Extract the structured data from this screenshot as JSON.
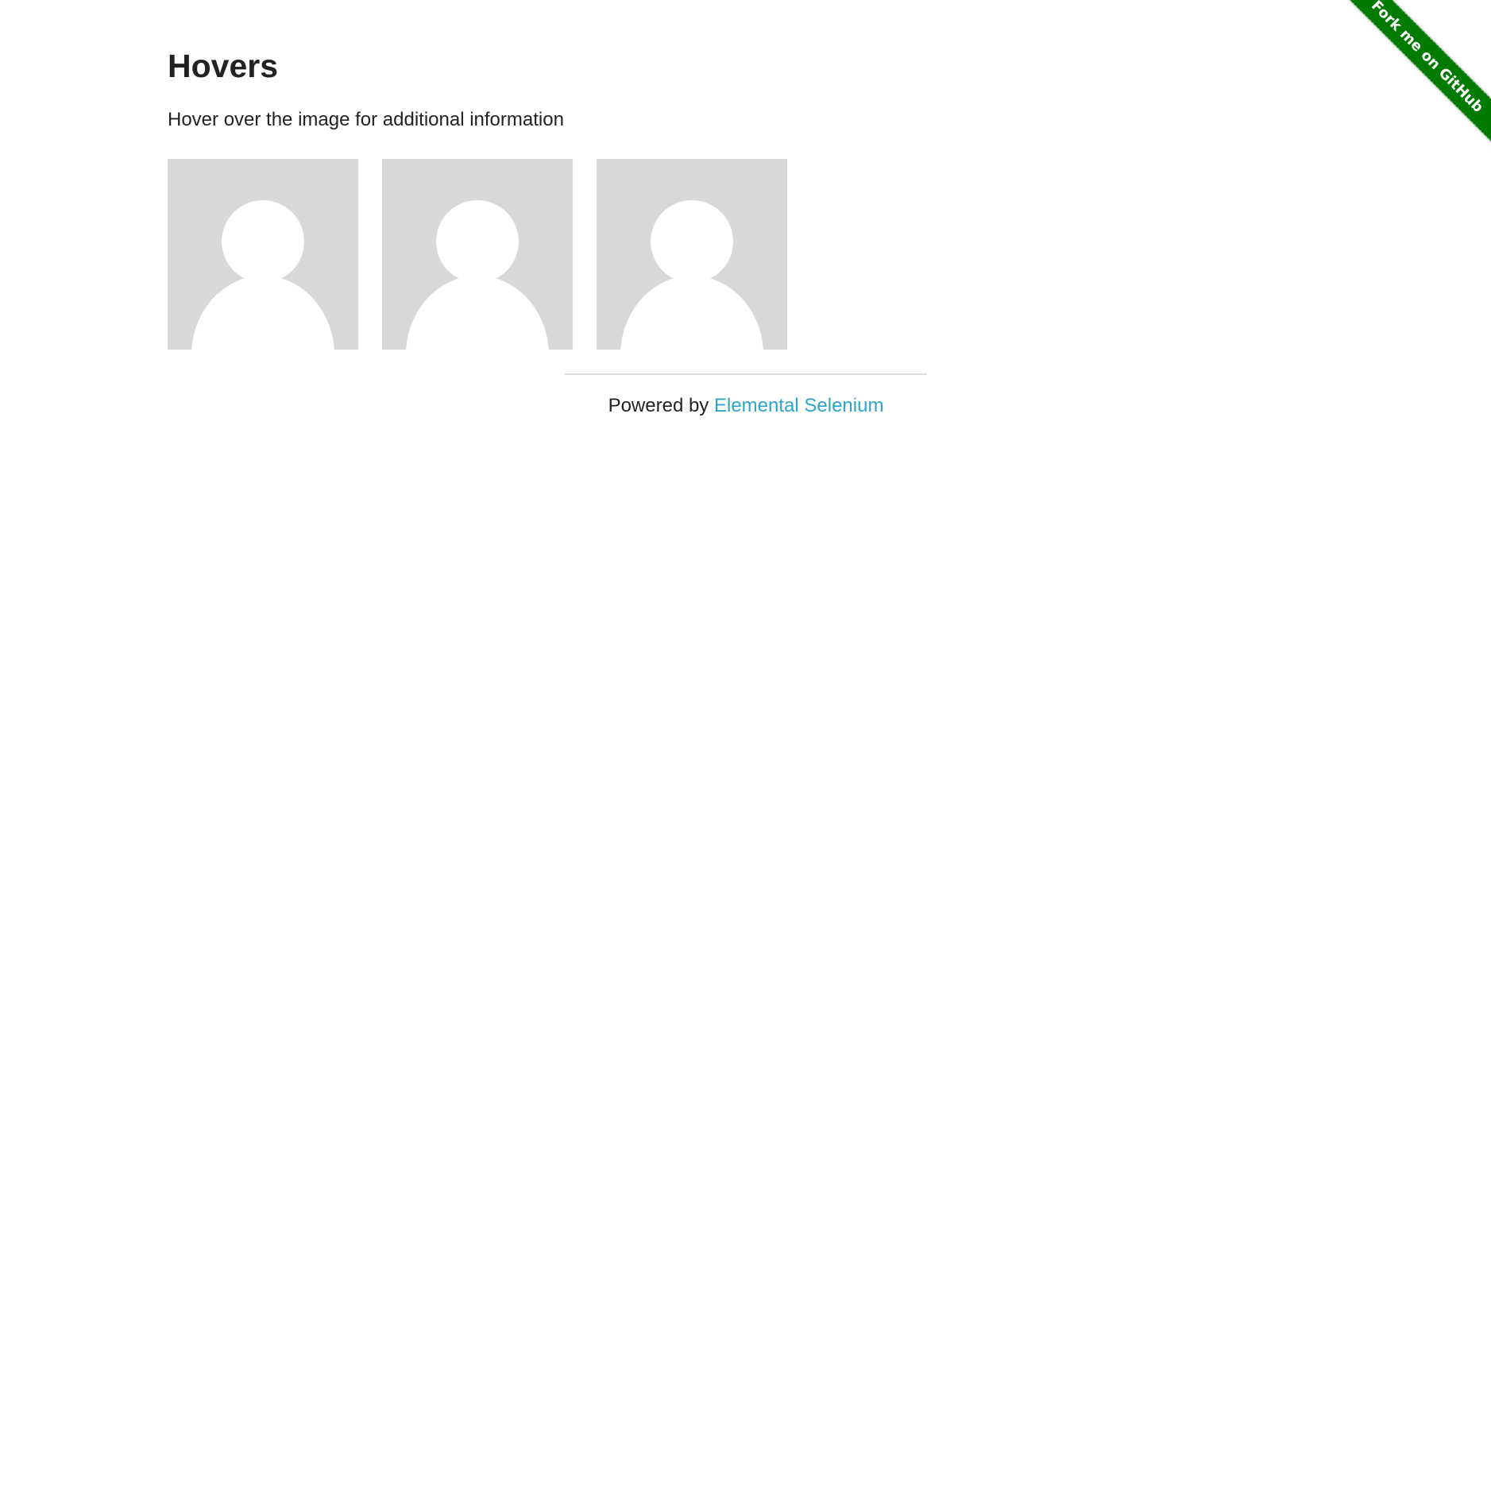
{
  "ribbon": {
    "label": "Fork me on GitHub",
    "color": "#007a00"
  },
  "page": {
    "title": "Hovers",
    "instructions": "Hover over the image for additional information"
  },
  "figures": [
    {
      "icon": "user-avatar-icon"
    },
    {
      "icon": "user-avatar-icon"
    },
    {
      "icon": "user-avatar-icon"
    }
  ],
  "footer": {
    "prefix": "Powered by",
    "link_label": "Elemental Selenium",
    "link_color": "#2ba6cb"
  }
}
